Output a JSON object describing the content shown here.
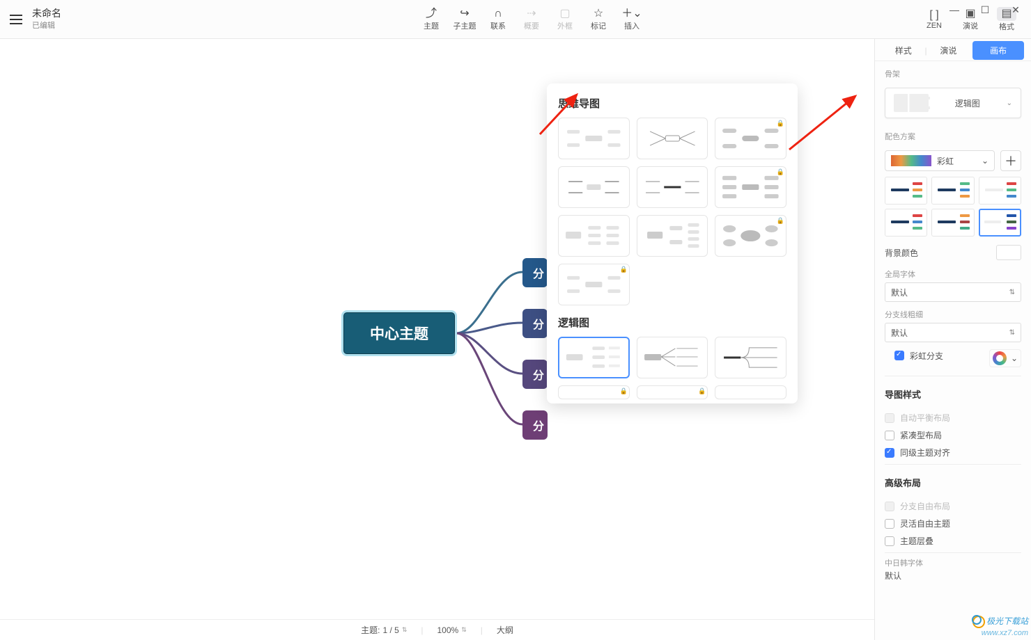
{
  "header": {
    "doc_title": "未命名",
    "doc_status": "已编辑",
    "tools": [
      {
        "icon": "⤴",
        "label": "主题",
        "disabled": false
      },
      {
        "icon": "↪",
        "label": "子主题",
        "disabled": false
      },
      {
        "icon": "∩",
        "label": "联系",
        "disabled": false
      },
      {
        "icon": "⇢",
        "label": "概要",
        "disabled": true
      },
      {
        "icon": "▢",
        "label": "外框",
        "disabled": true
      },
      {
        "icon": "☆",
        "label": "标记",
        "disabled": false
      },
      {
        "icon": "＋⌄",
        "label": "插入",
        "disabled": false
      }
    ],
    "right_tools": [
      {
        "icon": "[ ]",
        "label": "ZEN"
      },
      {
        "icon": "▣",
        "label": "演说"
      },
      {
        "icon": "▤",
        "label": "格式",
        "active": true
      }
    ]
  },
  "panel": {
    "tabs": {
      "style": "样式",
      "pitch": "演说",
      "canvas": "画布"
    },
    "skeleton_section": "骨架",
    "skeleton_value": "逻辑图",
    "color_section": "配色方案",
    "color_value": "彩虹",
    "bg_label": "背景颜色",
    "font_section": "全局字体",
    "font_value": "默认",
    "branch_section": "分支线粗细",
    "branch_value": "默认",
    "rainbow_branch": "彩虹分支",
    "map_style": "导图样式",
    "auto_balance": "自动平衡布局",
    "compact": "紧凑型布局",
    "same_align": "同级主题对齐",
    "adv_layout": "高级布局",
    "free_branch": "分支自由布局",
    "flex_topic": "灵活自由主题",
    "topic_stack": "主题层叠",
    "cjk_font": "中日韩字体",
    "cjk_value": "默认"
  },
  "popup": {
    "mindmap_title": "思维导图",
    "logic_title": "逻辑图"
  },
  "canvas_map": {
    "center": "中心主题",
    "subs": [
      "分",
      "分",
      "分",
      "分"
    ]
  },
  "status": {
    "topic_label": "主题:",
    "topic_value": "1 / 5",
    "zoom": "100%",
    "outline": "大纲"
  },
  "watermark": {
    "brand": "极光下载站",
    "url": "www.xz7.com"
  }
}
